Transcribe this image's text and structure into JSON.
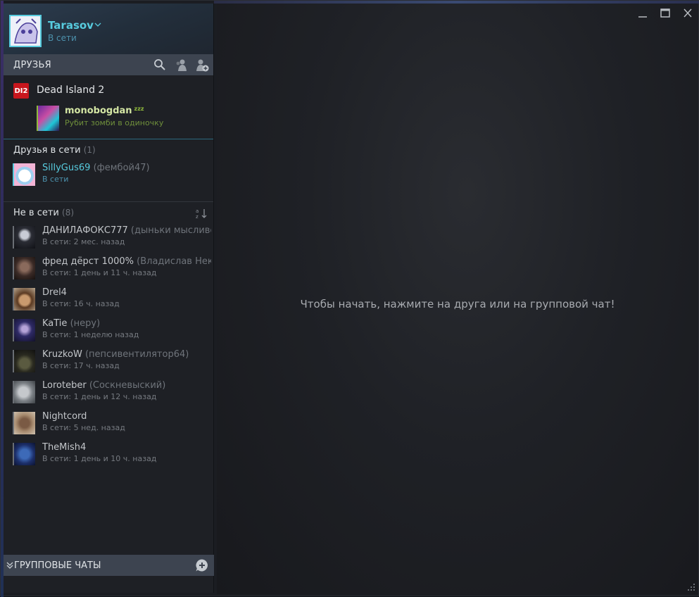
{
  "profile": {
    "name": "Tarasov",
    "status": "В сети"
  },
  "friends_bar": {
    "title": "ДРУЗЬЯ"
  },
  "in_game": {
    "game_name": "Dead Island 2",
    "game_icon_text": "DI2",
    "friend": {
      "name": "monobogdan",
      "away_badge": "zzz",
      "activity": "Рубит зомби в одиночку"
    }
  },
  "online": {
    "heading": "Друзья в сети",
    "count": "(1)",
    "friends": [
      {
        "name": "SillyGus69",
        "nick": "(фембой47)",
        "status": "В сети"
      }
    ]
  },
  "offline": {
    "heading": "Не в сети",
    "count": "(8)",
    "friends": [
      {
        "name": "ДАНИЛАФОКС777",
        "nick": "(дыньки мысливо",
        "status": "В сети: 2 мес. назад"
      },
      {
        "name": "фред дёрст 1000%",
        "nick": "(Владислав Нек",
        "status": "В сети: 1 день и 11 ч. назад"
      },
      {
        "name": "Drel4",
        "nick": "",
        "status": "В сети: 16 ч. назад"
      },
      {
        "name": "KaTie",
        "nick": "(нeру)",
        "status": "В сети: 1 неделю назад"
      },
      {
        "name": "KruzkoW",
        "nick": "(пепсивентилятор64)",
        "status": "В сети: 17 ч. назад"
      },
      {
        "name": "Loroteber",
        "nick": "(Соскневыский)",
        "status": "В сети: 1 день и 12 ч. назад"
      },
      {
        "name": "Nightcord",
        "nick": "",
        "status": "В сети: 5 нед. назад"
      },
      {
        "name": "TheMish4",
        "nick": "",
        "status": "В сети: 1 день и 10 ч. назад"
      }
    ]
  },
  "group_chats": {
    "label": "ГРУППОВЫЕ ЧАТЫ"
  },
  "chat": {
    "placeholder": "Чтобы начать, нажмите на друга или на групповой чат!"
  },
  "colors": {
    "online_accent": "#57cbde",
    "in_game_accent": "#90ba3c",
    "panel_bar": "#3d4450"
  }
}
